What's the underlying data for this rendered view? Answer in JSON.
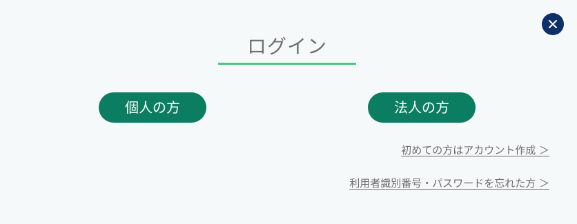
{
  "header": {
    "title": "ログイン",
    "close_icon": "close-icon"
  },
  "login_options": {
    "individual_label": "個人の方",
    "corporate_label": "法人の方"
  },
  "links": {
    "create_account": "初めての方はアカウント作成 ＞",
    "forgot_credentials": "利用者識別番号・パスワードを忘れた方 ＞"
  },
  "colors": {
    "background": "#f6f9fa",
    "primary_button": "#0b7d60",
    "accent_underline": "#4fc57f",
    "close_button": "#0f2f69",
    "text_gray": "#707070"
  }
}
